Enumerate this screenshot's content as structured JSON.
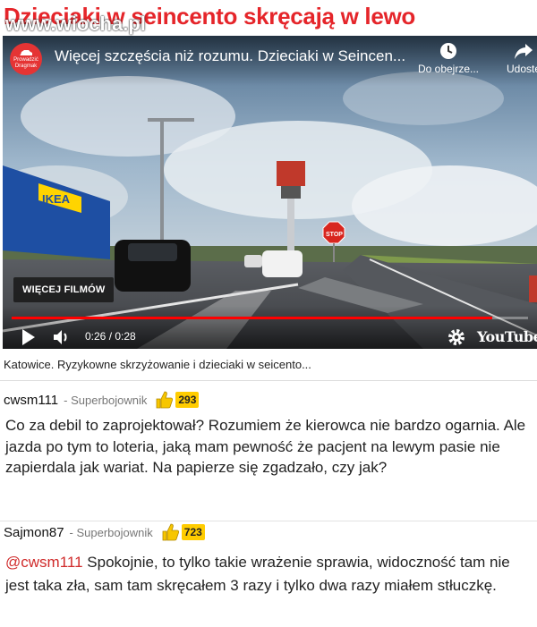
{
  "page": {
    "title": "Dzieciaki w seincento skręcają w lewo",
    "watermark": "www.wiocha.pl"
  },
  "video": {
    "channel_logo_lines": [
      "Prowadzić",
      "Dragmak"
    ],
    "title": "Więcej szczęścia niż rozumu. Dzieciaki w Seincen...",
    "watch_later_label": "Do obejrze...",
    "share_label": "Udostę",
    "more_videos_label": "WIĘCEJ FILMÓW",
    "current_time": "0:26",
    "duration": "0:28",
    "time_display": "0:26 / 0:28",
    "progress": 0.93,
    "youtube_logo": "YouTube",
    "scene_signs": {
      "ikea": "IKEA",
      "stop": "STOP"
    }
  },
  "caption": "Katowice. Ryzykowne skrzyżowanie i dzieciaki w seicento...",
  "comments": [
    {
      "username": "cwsm111",
      "rank": "- Superbojownik",
      "likes": "293",
      "text": "Co za debil to zaprojektował? Rozumiem że kierowca nie bardzo ogarnia. Ale jazda po tym to loteria, jaką mam pewność że pacjent na lewym pasie nie zapierdala jak wariat. Na papierze się zgadzało, czy jak?"
    },
    {
      "username": "Sajmon87",
      "rank": "- Superbojownik",
      "likes": "723",
      "mention": "@cwsm111",
      "text": " Spokojnie, to tylko takie wrażenie sprawia, widoczność tam nie jest taka zła, sam tam skręcałem 3 razy i tylko dwa razy miałem stłuczkę."
    }
  ],
  "colors": {
    "title_red": "#e5252a",
    "progress_red": "#ff0000",
    "likes_badge": "#ffcc00",
    "mention_red": "#d02b2b"
  },
  "icons": [
    "clock-icon",
    "share-icon",
    "play-icon",
    "volume-icon",
    "gear-icon",
    "thumbs-up-icon"
  ]
}
